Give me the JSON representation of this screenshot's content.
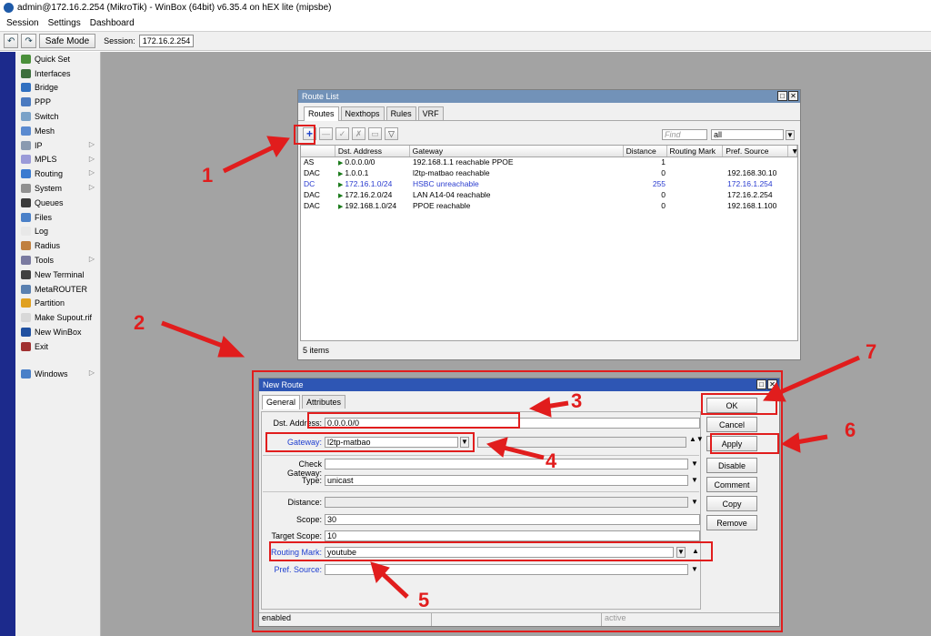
{
  "title": "admin@172.16.2.254 (MikroTik) - WinBox (64bit) v6.35.4 on hEX lite (mipsbe)",
  "menu": [
    "Session",
    "Settings",
    "Dashboard"
  ],
  "toolbar": {
    "safe_mode": "Safe Mode",
    "session_label": "Session:",
    "session_value": "172.16.2.254"
  },
  "sidebar": {
    "items": [
      {
        "label": "Quick Set",
        "icon": "quick-set-icon",
        "color": "#4a8f3a",
        "submenu": false
      },
      {
        "label": "Interfaces",
        "icon": "interfaces-icon",
        "color": "#3c6e3c",
        "submenu": false
      },
      {
        "label": "Bridge",
        "icon": "bridge-icon",
        "color": "#3070c0",
        "submenu": false
      },
      {
        "label": "PPP",
        "icon": "ppp-icon",
        "color": "#4a7ac0",
        "submenu": false
      },
      {
        "label": "Switch",
        "icon": "switch-icon",
        "color": "#7aa2c8",
        "submenu": false
      },
      {
        "label": "Mesh",
        "icon": "mesh-icon",
        "color": "#5a8ad0",
        "submenu": false
      },
      {
        "label": "IP",
        "icon": "ip-icon",
        "color": "#8a9ab0",
        "submenu": true
      },
      {
        "label": "MPLS",
        "icon": "mpls-icon",
        "color": "#9a9ad8",
        "submenu": true
      },
      {
        "label": "Routing",
        "icon": "routing-icon",
        "color": "#3a7ad0",
        "submenu": true
      },
      {
        "label": "System",
        "icon": "system-icon",
        "color": "#909090",
        "submenu": true
      },
      {
        "label": "Queues",
        "icon": "queues-icon",
        "color": "#3a3a3a",
        "submenu": false
      },
      {
        "label": "Files",
        "icon": "files-icon",
        "color": "#4a80c8",
        "submenu": false
      },
      {
        "label": "Log",
        "icon": "log-icon",
        "color": "#e8e8e8",
        "submenu": false
      },
      {
        "label": "Radius",
        "icon": "radius-icon",
        "color": "#c08040",
        "submenu": false
      },
      {
        "label": "Tools",
        "icon": "tools-icon",
        "color": "#7a7aa0",
        "submenu": true
      },
      {
        "label": "New Terminal",
        "icon": "terminal-icon",
        "color": "#404040",
        "submenu": false
      },
      {
        "label": "MetaROUTER",
        "icon": "metarouter-icon",
        "color": "#5a80b0",
        "submenu": false
      },
      {
        "label": "Partition",
        "icon": "partition-icon",
        "color": "#e0a020",
        "submenu": false
      },
      {
        "label": "Make Supout.rif",
        "icon": "supout-icon",
        "color": "#d8d8d8",
        "submenu": false
      },
      {
        "label": "New WinBox",
        "icon": "winbox-icon",
        "color": "#2050a0",
        "submenu": false
      },
      {
        "label": "Exit",
        "icon": "exit-icon",
        "color": "#a03030",
        "submenu": false
      }
    ],
    "windows": "Windows"
  },
  "route_list": {
    "title": "Route List",
    "tabs": [
      "Routes",
      "Nexthops",
      "Rules",
      "VRF"
    ],
    "find_placeholder": "Find",
    "filter": "all",
    "columns": [
      "",
      "Dst. Address",
      "Gateway",
      "Distance",
      "Routing Mark",
      "Pref. Source"
    ],
    "rows": [
      {
        "flags": "AS",
        "dst": "0.0.0.0/0",
        "gateway": "192.168.1.1 reachable PPOE",
        "distance": "1",
        "mark": "",
        "pref": "",
        "dyn": false
      },
      {
        "flags": "DAC",
        "dst": "1.0.0.1",
        "gateway": "l2tp-matbao reachable",
        "distance": "0",
        "mark": "",
        "pref": "192.168.30.10",
        "dyn": false
      },
      {
        "flags": "DC",
        "dst": "172.16.1.0/24",
        "gateway": "HSBC unreachable",
        "distance": "255",
        "mark": "",
        "pref": "172.16.1.254",
        "dyn": true
      },
      {
        "flags": "DAC",
        "dst": "172.16.2.0/24",
        "gateway": "LAN A14-04 reachable",
        "distance": "0",
        "mark": "",
        "pref": "172.16.2.254",
        "dyn": false
      },
      {
        "flags": "DAC",
        "dst": "192.168.1.0/24",
        "gateway": "PPOE reachable",
        "distance": "0",
        "mark": "",
        "pref": "192.168.1.100",
        "dyn": false
      }
    ],
    "count": "5 items"
  },
  "new_route": {
    "title": "New Route",
    "tabs": [
      "General",
      "Attributes"
    ],
    "dst_label": "Dst. Address:",
    "dst_value": "0.0.0.0/0",
    "gateway_label": "Gateway:",
    "gateway_value": "l2tp-matbao",
    "check_gateway_label": "Check Gateway:",
    "type_label": "Type:",
    "type_value": "unicast",
    "distance_label": "Distance:",
    "scope_label": "Scope:",
    "scope_value": "30",
    "target_scope_label": "Target Scope:",
    "target_scope_value": "10",
    "routing_mark_label": "Routing Mark:",
    "routing_mark_value": "youtube",
    "pref_source_label": "Pref. Source:",
    "buttons": [
      "OK",
      "Cancel",
      "Apply",
      "Disable",
      "Comment",
      "Copy",
      "Remove"
    ],
    "status_left": "enabled",
    "status_right": "active"
  },
  "annotations": [
    "1",
    "2",
    "3",
    "4",
    "5",
    "6",
    "7"
  ],
  "colors": {
    "annotation": "#e11d1d",
    "title_active": "#2e56b4",
    "desktop": "#a3a3a3",
    "sidebar_strip": "#1c2a8c",
    "dynamic_row": "#2a3ccf"
  }
}
